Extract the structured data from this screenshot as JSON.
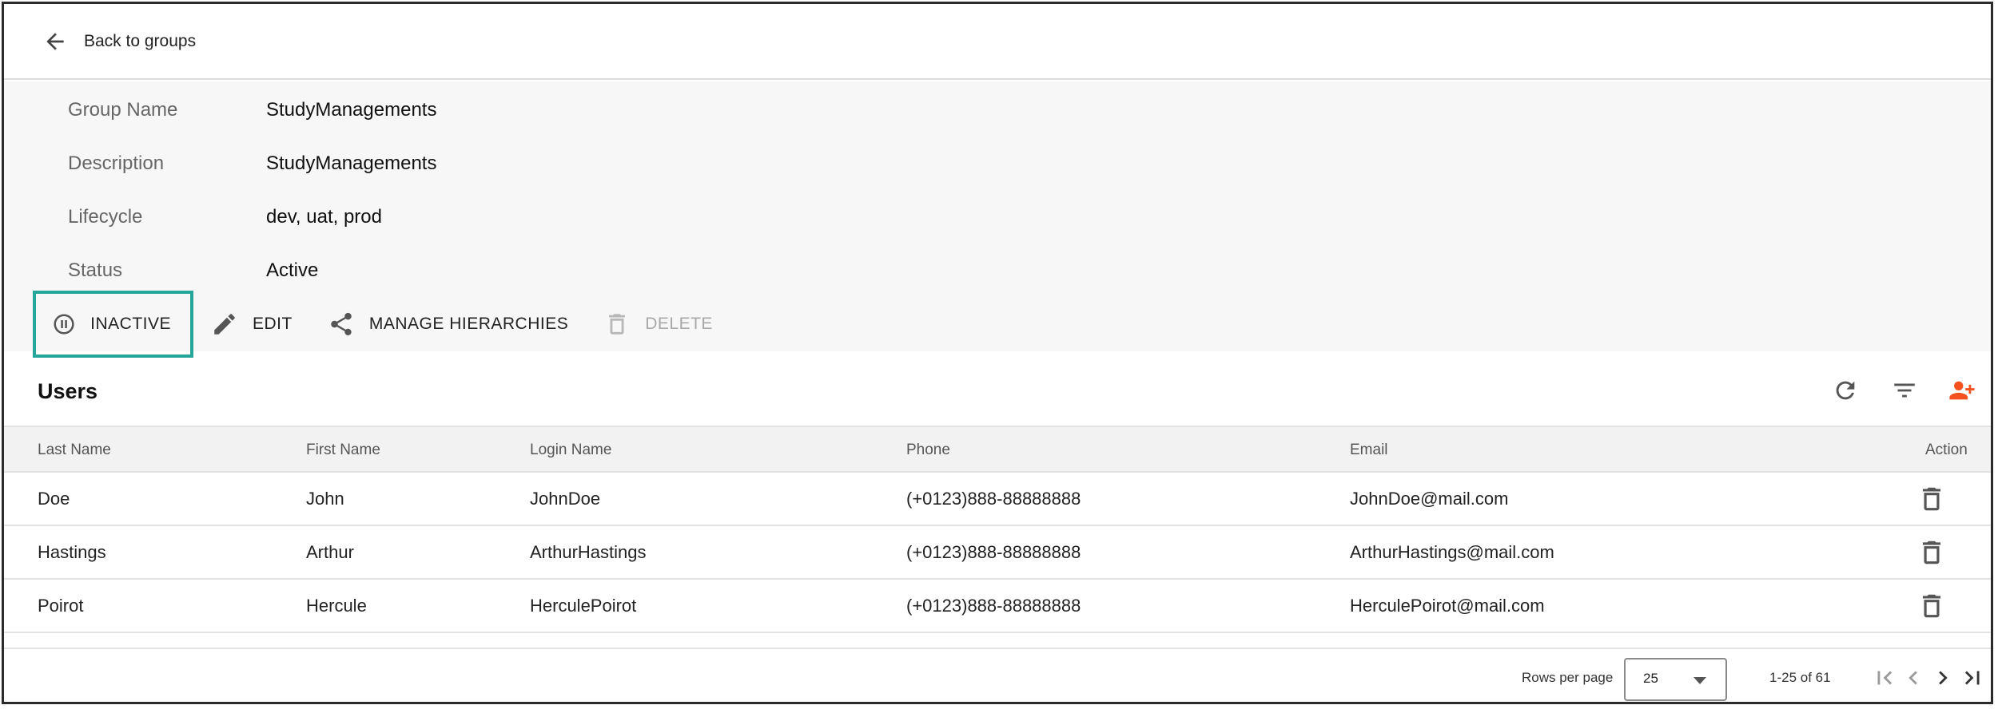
{
  "nav": {
    "back_label": "Back to groups"
  },
  "group": {
    "fields": [
      {
        "label": "Group Name",
        "value": "StudyManagements"
      },
      {
        "label": "Description",
        "value": "StudyManagements"
      },
      {
        "label": "Lifecycle",
        "value": "dev, uat, prod"
      },
      {
        "label": "Status",
        "value": "Active"
      }
    ]
  },
  "actions": {
    "inactive": "INACTIVE",
    "edit": "EDIT",
    "manage_hierarchies": "MANAGE HIERARCHIES",
    "delete": "DELETE"
  },
  "users": {
    "title": "Users",
    "accent_color": "#f4511e",
    "highlight_color": "#26a69a",
    "columns": [
      "Last Name",
      "First Name",
      "Login Name",
      "Phone",
      "Email",
      "Action"
    ],
    "rows": [
      [
        "Doe",
        "John",
        "JohnDoe",
        "(+0123)888-88888888",
        "JohnDoe@mail.com"
      ],
      [
        "Hastings",
        "Arthur",
        "ArthurHastings",
        "(+0123)888-88888888",
        "ArthurHastings@mail.com"
      ],
      [
        "Poirot",
        "Hercule",
        "HerculePoirot",
        "(+0123)888-88888888",
        "HerculePoirot@mail.com"
      ]
    ]
  },
  "pagination": {
    "rows_per_page_label": "Rows per page",
    "rows_per_page_value": "25",
    "range_text": "1-25 of 61"
  },
  "icons": [
    "arrow-left-icon",
    "pause-circle-icon",
    "pencil-icon",
    "share-icon",
    "trash-icon",
    "refresh-icon",
    "filter-icon",
    "add-user-icon",
    "first-page-icon",
    "prev-page-icon",
    "next-page-icon",
    "last-page-icon"
  ]
}
